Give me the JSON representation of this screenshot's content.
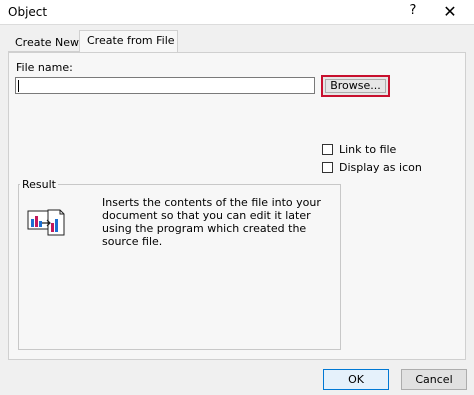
{
  "window": {
    "title": "Object",
    "help_label": "?",
    "close_label": "✕"
  },
  "tabs": [
    {
      "label": "Create New",
      "active": false
    },
    {
      "label": "Create from File",
      "active": true
    }
  ],
  "file": {
    "label": "File name:",
    "value": "",
    "browse_label": "Browse..."
  },
  "options": {
    "link_to_file": {
      "label": "Link to file",
      "checked": false
    },
    "display_as_icon": {
      "label": "Display as icon",
      "checked": false
    }
  },
  "result": {
    "label": "Result",
    "lines": [
      "Inserts the contents of the file into your",
      "document so that you can edit it later",
      "using the program which created the",
      "source file."
    ],
    "icon": "insert-file-icon"
  },
  "buttons": {
    "ok": "OK",
    "cancel": "Cancel"
  },
  "colors": {
    "highlight": "#c8102e",
    "accent": "#0078d4"
  }
}
